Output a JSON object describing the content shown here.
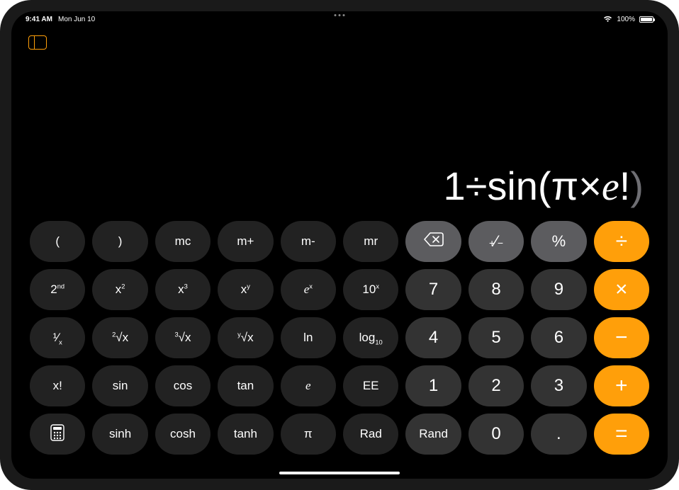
{
  "statusbar": {
    "time": "9:41 AM",
    "date": "Mon Jun 10",
    "battery_percent": "100%"
  },
  "display": {
    "expression_parts": [
      {
        "text": "1÷sin(π×",
        "class": ""
      },
      {
        "text": "e",
        "class": "ital"
      },
      {
        "text": "!",
        "class": ""
      },
      {
        "text": ")",
        "class": "dim"
      }
    ]
  },
  "keys": [
    {
      "name": "left-paren",
      "label": "(",
      "cls": "sci"
    },
    {
      "name": "right-paren",
      "label": ")",
      "cls": "sci"
    },
    {
      "name": "memory-clear",
      "label": "mc",
      "cls": "sci"
    },
    {
      "name": "memory-add",
      "label": "m+",
      "cls": "sci"
    },
    {
      "name": "memory-sub",
      "label": "m-",
      "cls": "sci"
    },
    {
      "name": "memory-recall",
      "label": "mr",
      "cls": "sci"
    },
    {
      "name": "backspace",
      "label": "",
      "cls": "ctl",
      "icon": "backspace"
    },
    {
      "name": "sign-toggle",
      "label": "",
      "cls": "ctl",
      "html": "<span style='font-size:14px'>+</span>⁄<span style='font-size:14px'>−</span>"
    },
    {
      "name": "percent",
      "label": "%",
      "cls": "ctl"
    },
    {
      "name": "divide",
      "label": "÷",
      "cls": "op"
    },
    {
      "name": "second",
      "label": "",
      "cls": "sci",
      "html": "2<sup>nd</sup>"
    },
    {
      "name": "square",
      "label": "",
      "cls": "sci",
      "html": "x<sup>2</sup>"
    },
    {
      "name": "cube",
      "label": "",
      "cls": "sci",
      "html": "x<sup>3</sup>"
    },
    {
      "name": "power",
      "label": "",
      "cls": "sci",
      "html": "x<sup>y</sup>"
    },
    {
      "name": "e-power-x",
      "label": "",
      "cls": "sci",
      "html": "<span class='ital'>e</span><sup>x</sup>"
    },
    {
      "name": "ten-power-x",
      "label": "",
      "cls": "sci",
      "html": "10<sup>x</sup>"
    },
    {
      "name": "digit-7",
      "label": "7",
      "cls": "num"
    },
    {
      "name": "digit-8",
      "label": "8",
      "cls": "num"
    },
    {
      "name": "digit-9",
      "label": "9",
      "cls": "num"
    },
    {
      "name": "multiply",
      "label": "×",
      "cls": "op"
    },
    {
      "name": "reciprocal",
      "label": "",
      "cls": "sci",
      "html": "¹⁄<sub>x</sub>"
    },
    {
      "name": "sqrt",
      "label": "",
      "cls": "sci",
      "html": "<sup>2</sup>√x"
    },
    {
      "name": "cbrt",
      "label": "",
      "cls": "sci",
      "html": "<sup>3</sup>√x"
    },
    {
      "name": "yroot",
      "label": "",
      "cls": "sci",
      "html": "<sup>y</sup>√x"
    },
    {
      "name": "ln",
      "label": "ln",
      "cls": "sci"
    },
    {
      "name": "log10",
      "label": "",
      "cls": "sci",
      "html": "log<sub>10</sub>"
    },
    {
      "name": "digit-4",
      "label": "4",
      "cls": "num"
    },
    {
      "name": "digit-5",
      "label": "5",
      "cls": "num"
    },
    {
      "name": "digit-6",
      "label": "6",
      "cls": "num"
    },
    {
      "name": "subtract",
      "label": "−",
      "cls": "op"
    },
    {
      "name": "factorial",
      "label": "x!",
      "cls": "sci"
    },
    {
      "name": "sin",
      "label": "sin",
      "cls": "sci"
    },
    {
      "name": "cos",
      "label": "cos",
      "cls": "sci"
    },
    {
      "name": "tan",
      "label": "tan",
      "cls": "sci"
    },
    {
      "name": "euler-e",
      "label": "",
      "cls": "sci",
      "html": "<span class='ital'>e</span>"
    },
    {
      "name": "ee-exponent",
      "label": "EE",
      "cls": "sci"
    },
    {
      "name": "digit-1",
      "label": "1",
      "cls": "num"
    },
    {
      "name": "digit-2",
      "label": "2",
      "cls": "num"
    },
    {
      "name": "digit-3",
      "label": "3",
      "cls": "num"
    },
    {
      "name": "add",
      "label": "+",
      "cls": "op"
    },
    {
      "name": "calc-mode",
      "label": "",
      "cls": "sci",
      "icon": "calc"
    },
    {
      "name": "sinh",
      "label": "sinh",
      "cls": "sci"
    },
    {
      "name": "cosh",
      "label": "cosh",
      "cls": "sci"
    },
    {
      "name": "tanh",
      "label": "tanh",
      "cls": "sci"
    },
    {
      "name": "pi",
      "label": "π",
      "cls": "sci"
    },
    {
      "name": "rad-deg",
      "label": "Rad",
      "cls": "sci"
    },
    {
      "name": "rand",
      "label": "Rand",
      "cls": "num",
      "smalltext": true
    },
    {
      "name": "digit-0",
      "label": "0",
      "cls": "num"
    },
    {
      "name": "decimal",
      "label": ".",
      "cls": "num"
    },
    {
      "name": "equals",
      "label": "=",
      "cls": "op"
    }
  ]
}
